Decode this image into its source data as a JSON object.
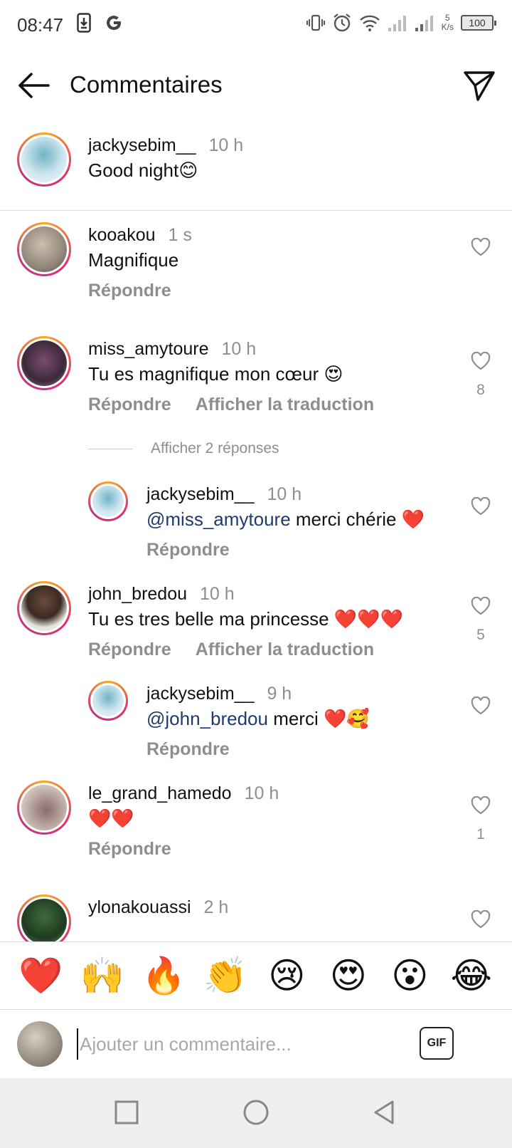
{
  "status_bar": {
    "time": "08:47",
    "net_speed_value": "5",
    "net_speed_unit": "K/s",
    "battery": "100"
  },
  "header": {
    "title": "Commentaires"
  },
  "caption": {
    "username": "jackysebim__",
    "time": "10 h",
    "text": "Good night😊"
  },
  "comments": [
    {
      "username": "kooakou",
      "time": "1 s",
      "text": "Magnifique",
      "reply": "Répondre",
      "translate": "",
      "likes": ""
    },
    {
      "username": "miss_amytoure",
      "time": "10 h",
      "text": "Tu es magnifique mon cœur 😍",
      "reply": "Répondre",
      "translate": "Afficher la traduction",
      "likes": "8"
    },
    {
      "username": "john_bredou",
      "time": "10 h",
      "text": "Tu es tres belle ma princesse ❤️❤️❤️",
      "reply": "Répondre",
      "translate": "Afficher la traduction",
      "likes": "5"
    },
    {
      "username": "le_grand_hamedo",
      "time": "10 h",
      "text": "❤️❤️",
      "reply": "Répondre",
      "translate": "",
      "likes": "1"
    },
    {
      "username": "ylonakouassi",
      "time": "2 h",
      "text": "",
      "reply": "",
      "translate": "",
      "likes": ""
    }
  ],
  "view_replies": "Afficher 2 réponses",
  "replies": [
    {
      "username": "jackysebim__",
      "time": "10 h",
      "mention": "@miss_amytoure",
      "text": " merci chérie ❤️",
      "reply": "Répondre"
    },
    {
      "username": "jackysebim__",
      "time": "9 h",
      "mention": "@john_bredou",
      "text": " merci ❤️🥰",
      "reply": "Répondre"
    }
  ],
  "emoji_bar": [
    "❤️",
    "🙌",
    "🔥",
    "👏",
    "😢",
    "😍",
    "😮",
    "😂"
  ],
  "composer": {
    "placeholder": "Ajouter un commentaire...",
    "gif_label": "GIF"
  },
  "icons": {
    "back": "arrow-left-icon",
    "share": "paper-plane-icon",
    "heart": "heart-outline-icon",
    "nav_square": "recents-icon",
    "nav_circle": "home-icon",
    "nav_triangle": "back-triangle-icon"
  }
}
